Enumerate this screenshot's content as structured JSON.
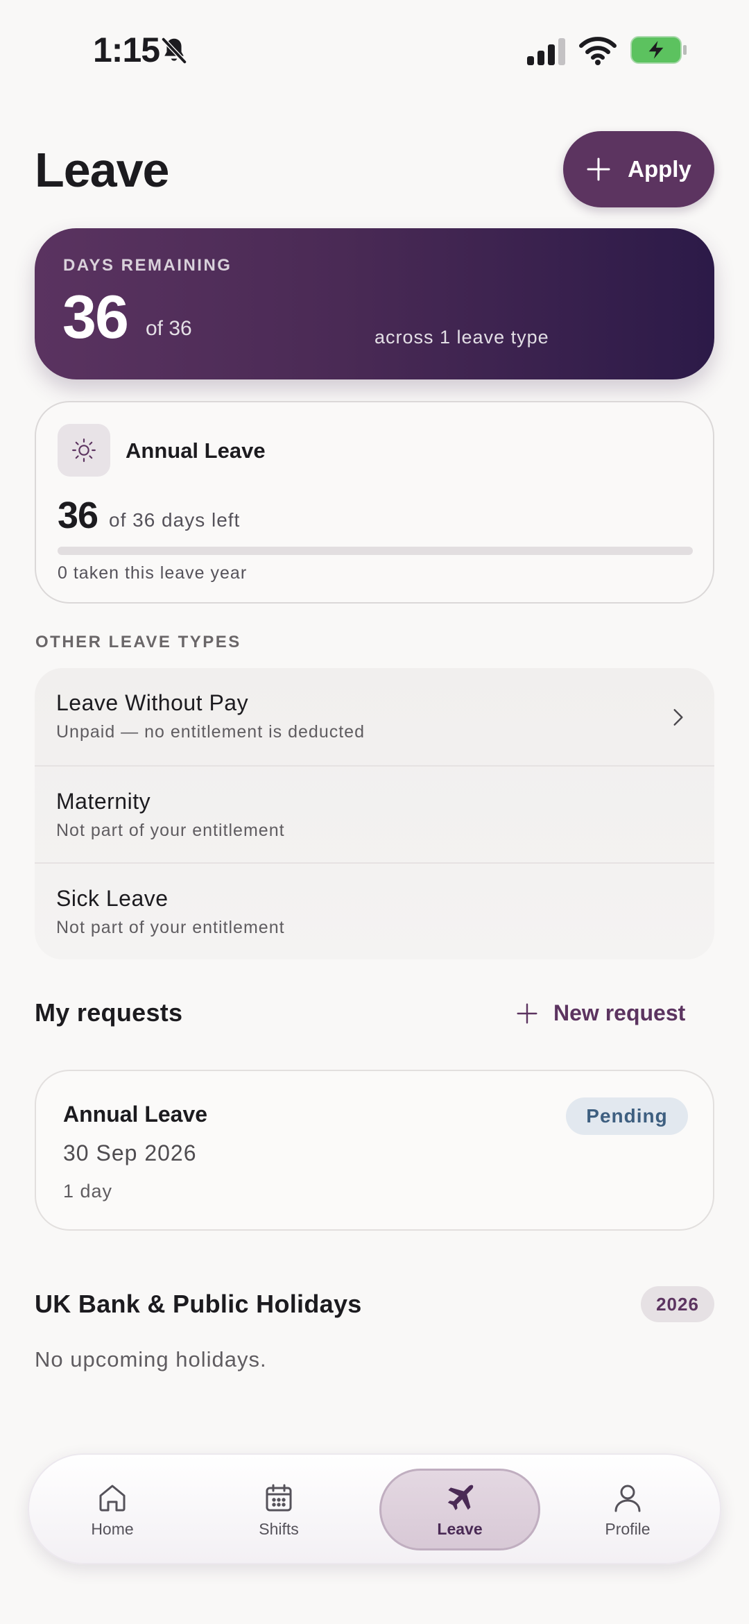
{
  "status_bar": {
    "time": "1:15"
  },
  "header": {
    "title": "Leave",
    "apply_label": "Apply"
  },
  "summary": {
    "label": "DAYS REMAINING",
    "remaining": "36",
    "of_total": "of 36",
    "across": "across 1 leave type"
  },
  "annual_leave": {
    "title": "Annual Leave",
    "remaining": "36",
    "of_text": "of 36 days left",
    "used_fraction": 0,
    "taken_text": "0 taken this leave year"
  },
  "other_leave": {
    "label": "OTHER LEAVE TYPES",
    "items": [
      {
        "name": "Leave Without Pay",
        "sub": "Unpaid — no entitlement is deducted"
      },
      {
        "name": "Maternity",
        "sub": "Not part of your entitlement"
      },
      {
        "name": "Sick Leave",
        "sub": "Not part of your entitlement"
      }
    ]
  },
  "requests": {
    "title": "My requests",
    "new_label": "New request",
    "items": [
      {
        "type": "Annual Leave",
        "date": "30 Sep 2026",
        "days": "1 day",
        "status": "Pending"
      }
    ]
  },
  "holidays": {
    "title": "UK Bank & Public Holidays",
    "year": "2026",
    "empty": "No upcoming holidays."
  },
  "nav": {
    "items": [
      {
        "label": "Home",
        "icon": "home-icon"
      },
      {
        "label": "Shifts",
        "icon": "calendar-icon"
      },
      {
        "label": "Leave",
        "icon": "plane-icon"
      },
      {
        "label": "Profile",
        "icon": "user-icon"
      }
    ],
    "active": "Leave"
  },
  "colors": {
    "accent": "#5c3460",
    "hero_start": "#5a3360",
    "hero_end": "#2c1a48",
    "pending_bg": "#e2e8ef",
    "pending_text": "#3e5f80",
    "battery": "#5cc25f"
  }
}
